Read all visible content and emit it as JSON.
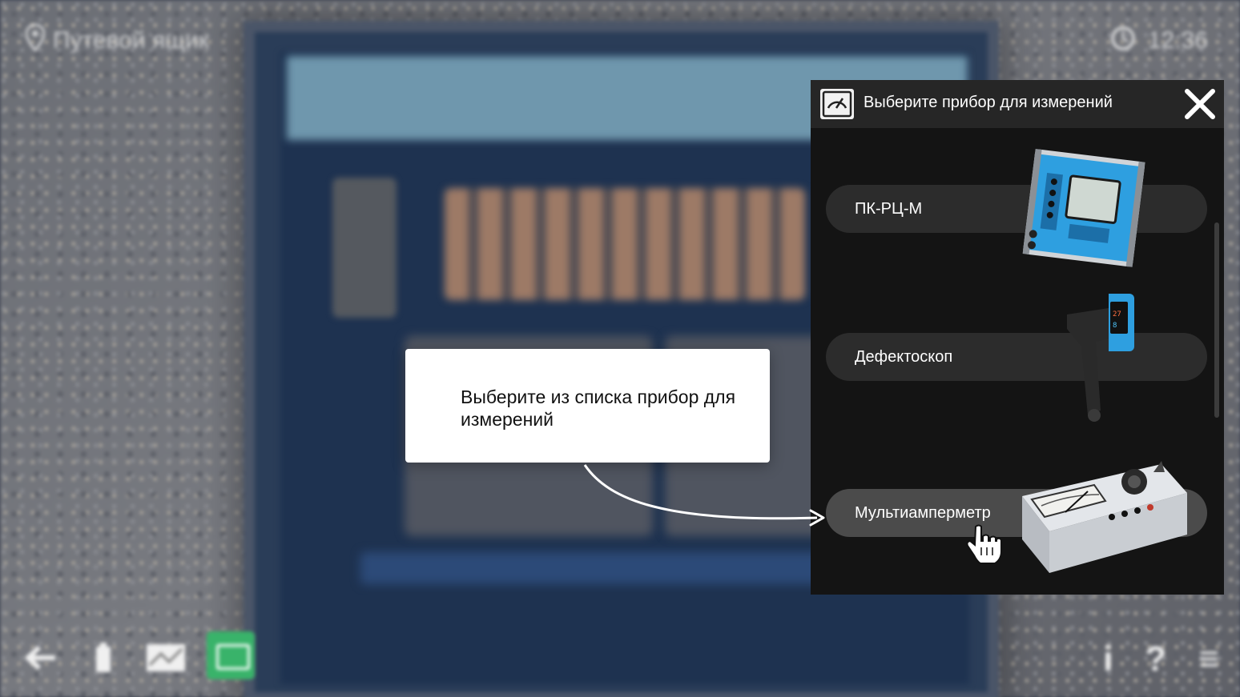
{
  "hud": {
    "location": "Путевой ящик",
    "time": "12:36",
    "right_buttons": [
      "i",
      "?",
      "≡"
    ]
  },
  "panel": {
    "title": "Выберите прибор для измерений",
    "items": [
      {
        "label": "ПК-РЦ-М"
      },
      {
        "label": "Дефектоскоп"
      },
      {
        "label": "Мультиамперметр"
      }
    ]
  },
  "tooltip": {
    "text": "Выберите из списка прибор для измерений"
  },
  "colors": {
    "panel_bg": "#141414",
    "header_bg": "#262626",
    "item_bg": "#2c2c2c",
    "item_hover_bg": "#4b4b4b",
    "device_screen_blue": "#2e9fe0",
    "hud_green": "#39b36a"
  },
  "icons": {
    "header": "gauge-icon",
    "close": "close-icon",
    "location": "location-pin-icon",
    "clock": "clock-icon",
    "back": "arrow-left-icon",
    "cursor": "hand-pointer-icon"
  }
}
